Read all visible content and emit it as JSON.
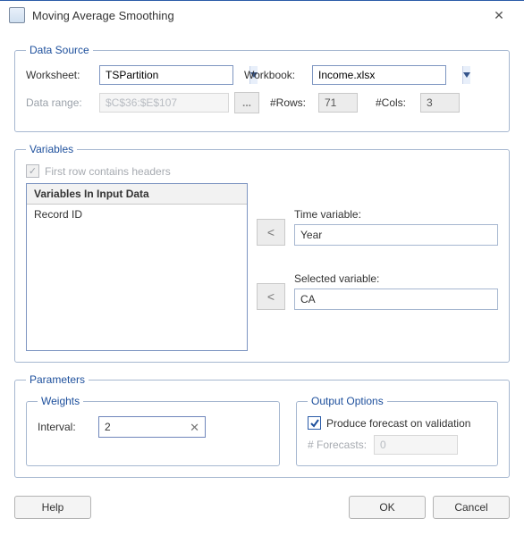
{
  "window": {
    "title": "Moving Average Smoothing"
  },
  "dataSource": {
    "legend": "Data Source",
    "worksheetLabel": "Worksheet:",
    "worksheetValue": "TSPartition",
    "workbookLabel": "Workbook:",
    "workbookValue": "Income.xlsx",
    "dataRangeLabel": "Data range:",
    "dataRangeValue": "$C$36:$E$107",
    "dotsLabel": "...",
    "rowsLabel": "#Rows:",
    "rowsValue": "71",
    "colsLabel": "#Cols:",
    "colsValue": "3"
  },
  "variables": {
    "legend": "Variables",
    "firstRowLabel": "First row contains headers",
    "listHeader": "Variables In Input Data",
    "listItem0": "Record ID",
    "timeVarLabel": "Time variable:",
    "timeVarValue": "Year",
    "selVarLabel": "Selected variable:",
    "selVarValue": "CA",
    "moveGlyph": "<"
  },
  "parameters": {
    "legend": "Parameters",
    "weightsLegend": "Weights",
    "intervalLabel": "Interval:",
    "intervalValue": "2",
    "outputLegend": "Output Options",
    "produceForecastLabel": "Produce forecast on validation",
    "forecastsLabel": "# Forecasts:",
    "forecastsValue": "0"
  },
  "footer": {
    "help": "Help",
    "ok": "OK",
    "cancel": "Cancel"
  }
}
